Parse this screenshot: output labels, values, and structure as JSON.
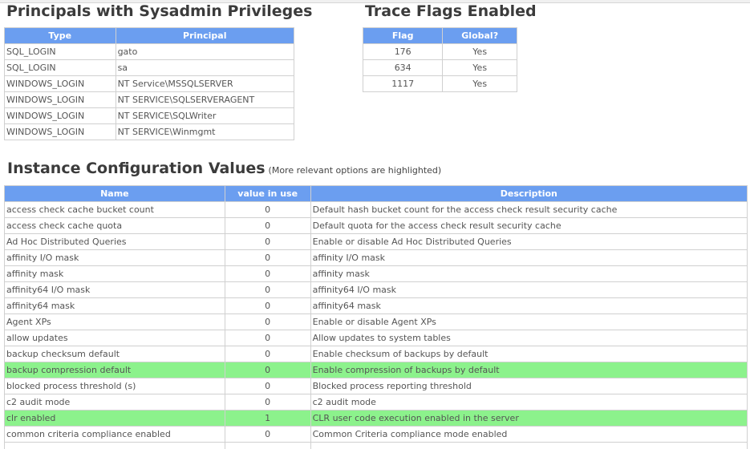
{
  "principals": {
    "title": "Principals with Sysadmin Privileges",
    "columns": [
      "Type",
      "Principal"
    ],
    "rows": [
      [
        "SQL_LOGIN",
        "gato"
      ],
      [
        "SQL_LOGIN",
        "sa"
      ],
      [
        "WINDOWS_LOGIN",
        "NT Service\\MSSQLSERVER"
      ],
      [
        "WINDOWS_LOGIN",
        "NT SERVICE\\SQLSERVERAGENT"
      ],
      [
        "WINDOWS_LOGIN",
        "NT SERVICE\\SQLWriter"
      ],
      [
        "WINDOWS_LOGIN",
        "NT SERVICE\\Winmgmt"
      ]
    ]
  },
  "trace_flags": {
    "title": "Trace Flags Enabled",
    "columns": [
      "Flag",
      "Global?"
    ],
    "rows": [
      [
        "176",
        "Yes"
      ],
      [
        "634",
        "Yes"
      ],
      [
        "1117",
        "Yes"
      ]
    ]
  },
  "config": {
    "title": "Instance Configuration Values",
    "note": "(More relevant options are highlighted)",
    "highlight_color": "#8cf28c",
    "header_color": "#6b9ef0",
    "columns": [
      "Name",
      "value in use",
      "Description"
    ],
    "rows": [
      {
        "name": "access check cache bucket count",
        "value": "0",
        "desc": "Default hash bucket count for the access check result security cache",
        "highlight": false
      },
      {
        "name": "access check cache quota",
        "value": "0",
        "desc": "Default quota for the access check result security cache",
        "highlight": false
      },
      {
        "name": "Ad Hoc Distributed Queries",
        "value": "0",
        "desc": "Enable or disable Ad Hoc Distributed Queries",
        "highlight": false
      },
      {
        "name": "affinity I/O mask",
        "value": "0",
        "desc": "affinity I/O mask",
        "highlight": false
      },
      {
        "name": "affinity mask",
        "value": "0",
        "desc": "affinity mask",
        "highlight": false
      },
      {
        "name": "affinity64 I/O mask",
        "value": "0",
        "desc": "affinity64 I/O mask",
        "highlight": false
      },
      {
        "name": "affinity64 mask",
        "value": "0",
        "desc": "affinity64 mask",
        "highlight": false
      },
      {
        "name": "Agent XPs",
        "value": "0",
        "desc": "Enable or disable Agent XPs",
        "highlight": false
      },
      {
        "name": "allow updates",
        "value": "0",
        "desc": "Allow updates to system tables",
        "highlight": false
      },
      {
        "name": "backup checksum default",
        "value": "0",
        "desc": "Enable checksum of backups by default",
        "highlight": false
      },
      {
        "name": "backup compression default",
        "value": "0",
        "desc": "Enable compression of backups by default",
        "highlight": true
      },
      {
        "name": "blocked process threshold (s)",
        "value": "0",
        "desc": "Blocked process reporting threshold",
        "highlight": false
      },
      {
        "name": "c2 audit mode",
        "value": "0",
        "desc": "c2 audit mode",
        "highlight": false
      },
      {
        "name": "clr enabled",
        "value": "1",
        "desc": "CLR user code execution enabled in the server",
        "highlight": true
      },
      {
        "name": "common criteria compliance enabled",
        "value": "0",
        "desc": "Common Criteria compliance mode enabled",
        "highlight": false
      },
      {
        "name": "",
        "value": "",
        "desc": "",
        "highlight": false
      }
    ]
  }
}
